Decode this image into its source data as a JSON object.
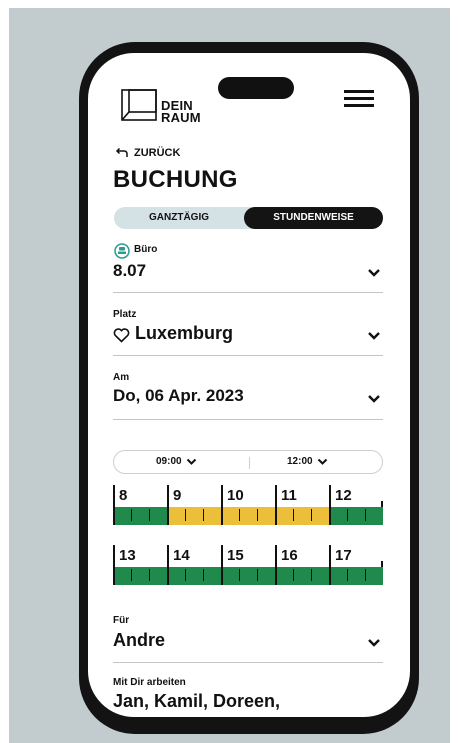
{
  "brand": {
    "logo_line1": "DEIN",
    "logo_line2": "RAUM"
  },
  "nav": {
    "back_label": "ZURÜCK"
  },
  "page": {
    "title": "BUCHUNG"
  },
  "mode_toggle": {
    "options": [
      "GANZTÄGIG",
      "STUNDENWEISE"
    ],
    "selected": "STUNDENWEISE"
  },
  "office": {
    "label": "Büro",
    "value": "8.07"
  },
  "seat": {
    "label": "Platz",
    "value": "Luxemburg"
  },
  "date": {
    "label": "Am",
    "value": "Do, 06 Apr. 2023"
  },
  "time_range": {
    "start": "09:00",
    "end": "12:00"
  },
  "hours_row1": [
    {
      "hour": "8",
      "status": "available"
    },
    {
      "hour": "9",
      "status": "selected"
    },
    {
      "hour": "10",
      "status": "selected"
    },
    {
      "hour": "11",
      "status": "selected"
    },
    {
      "hour": "12",
      "status": "available"
    }
  ],
  "hours_row2": [
    {
      "hour": "13",
      "status": "available"
    },
    {
      "hour": "14",
      "status": "available"
    },
    {
      "hour": "15",
      "status": "available"
    },
    {
      "hour": "16",
      "status": "available"
    },
    {
      "hour": "17",
      "status": "available"
    }
  ],
  "for_person": {
    "label": "Für",
    "value": "Andre"
  },
  "colleagues": {
    "label": "Mit Dir arbeiten",
    "value": "Jan, Kamil, Doreen,"
  },
  "colors": {
    "available": "#1f8a4c",
    "selected": "#ecbf3a",
    "toggle_bg": "#d4e1e5",
    "background": "#c2cccf",
    "office_icon": "#2a9d8f"
  }
}
